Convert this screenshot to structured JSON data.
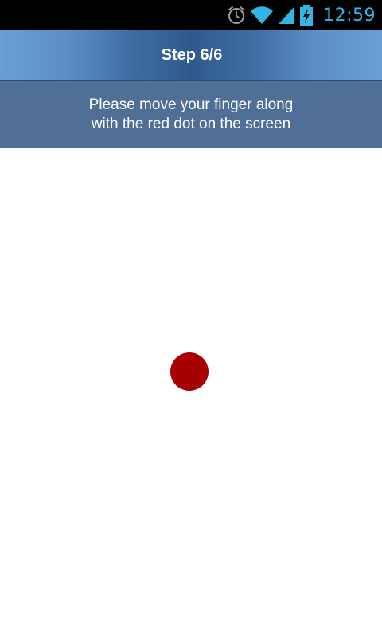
{
  "status_bar": {
    "time": "12:59",
    "icons": [
      "alarm-icon",
      "wifi-icon",
      "signal-icon",
      "battery-charging-icon"
    ],
    "accent_color": "#33b5e5"
  },
  "header": {
    "title": "Step 6/6"
  },
  "instruction": {
    "text": "Please move your finger along\n with the red dot on the screen"
  },
  "touch_target": {
    "color": "#a80000"
  }
}
